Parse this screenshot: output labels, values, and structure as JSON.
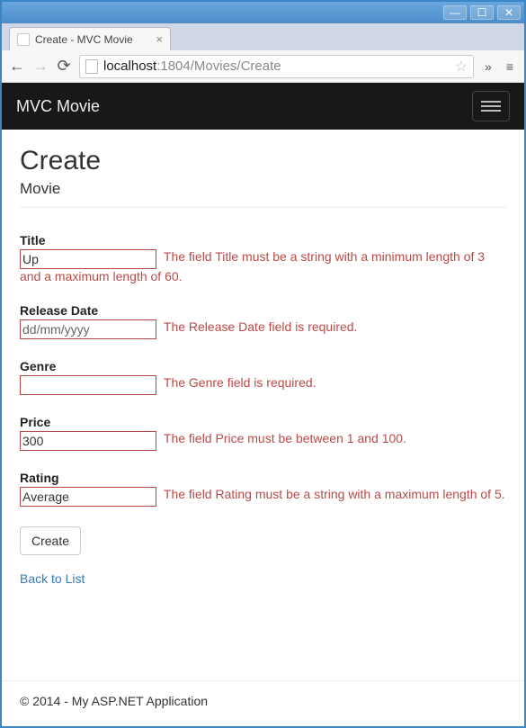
{
  "browser": {
    "tab_title": "Create - MVC Movie",
    "url_host": "localhost",
    "url_port_path": ":1804/Movies/Create"
  },
  "navbar": {
    "brand": "MVC Movie"
  },
  "page": {
    "heading": "Create",
    "subheading": "Movie"
  },
  "form": {
    "title": {
      "label": "Title",
      "value": "Up",
      "error": "The field Title must be a string with a minimum length of 3 and a maximum length of 60."
    },
    "release_date": {
      "label": "Release Date",
      "value": "dd/mm/yyyy",
      "error": "The Release Date field is required."
    },
    "genre": {
      "label": "Genre",
      "value": "",
      "error": "The Genre field is required."
    },
    "price": {
      "label": "Price",
      "value": "300",
      "error": "The field Price must be between 1 and 100."
    },
    "rating": {
      "label": "Rating",
      "value": "Average",
      "error": "The field Rating must be a string with a maximum length of 5."
    },
    "submit_label": "Create",
    "back_link": "Back to List"
  },
  "footer": {
    "text": "© 2014 - My ASP.NET Application"
  }
}
